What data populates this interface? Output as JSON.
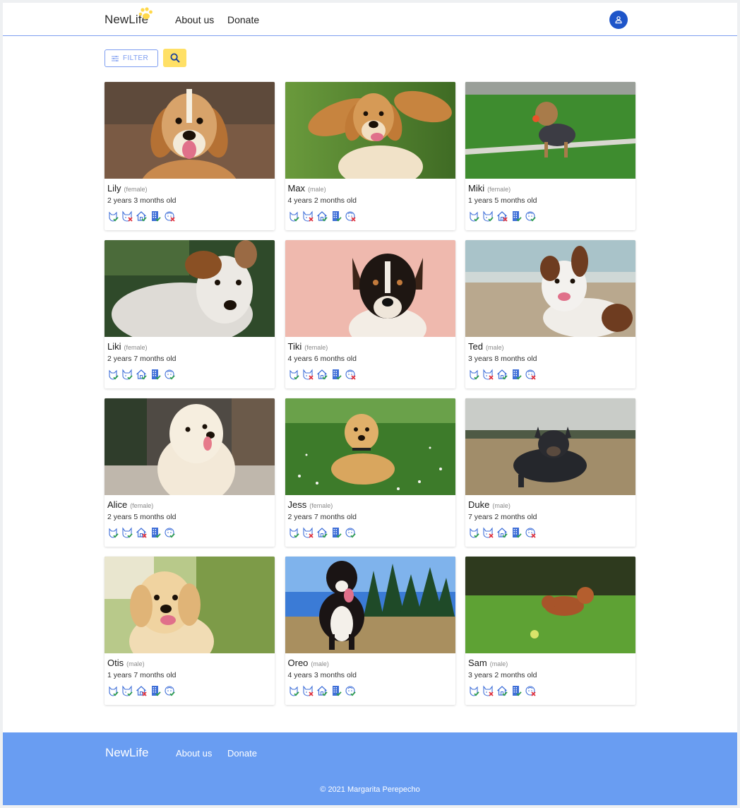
{
  "header": {
    "logo": "NewLife",
    "nav": [
      "About us",
      "Donate"
    ]
  },
  "toolbar": {
    "filter_label": "FILTER"
  },
  "colors": {
    "accent": "#1e55c9",
    "border_blue": "#7d9df0",
    "search_yellow": "#ffe066",
    "footer_blue": "#699df2",
    "ok_green": "#2e9e4c",
    "no_red": "#e2343f",
    "icon_blue": "#3f6fd8"
  },
  "pets": [
    {
      "name": "Lily",
      "gender": "(female)",
      "age": "2 years 3 months old",
      "photo": "beagle-smiling",
      "badges": [
        "ok",
        "no",
        "ok",
        "ok",
        "no"
      ]
    },
    {
      "name": "Max",
      "gender": "(male)",
      "age": "4 years 2 months old",
      "photo": "spaniel-in-grass",
      "badges": [
        "ok",
        "no",
        "ok",
        "ok",
        "no"
      ]
    },
    {
      "name": "Miki",
      "gender": "(female)",
      "age": "1 years 5 months old",
      "photo": "yorkie-with-ball",
      "badges": [
        "ok",
        "ok",
        "no",
        "ok",
        "ok"
      ]
    },
    {
      "name": "Liki",
      "gender": "(female)",
      "age": "2 years 7 months old",
      "photo": "jack-russell-white",
      "badges": [
        "ok",
        "ok",
        "ok",
        "ok",
        "ok"
      ]
    },
    {
      "name": "Tiki",
      "gender": "(female)",
      "age": "4 years 6 months old",
      "photo": "terrier-pink-bg",
      "badges": [
        "ok",
        "no",
        "ok",
        "ok",
        "no"
      ]
    },
    {
      "name": "Ted",
      "gender": "(male)",
      "age": "3 years 8 months old",
      "photo": "collie-mix-beach",
      "badges": [
        "ok",
        "no",
        "ok",
        "ok",
        "no"
      ]
    },
    {
      "name": "Alice",
      "gender": "(female)",
      "age": "2 years 5 months old",
      "photo": "white-fluffy-dog",
      "badges": [
        "ok",
        "ok",
        "no",
        "ok",
        "ok"
      ]
    },
    {
      "name": "Jess",
      "gender": "(female)",
      "age": "2 years 7 months old",
      "photo": "golden-in-meadow",
      "badges": [
        "ok",
        "no",
        "ok",
        "ok",
        "ok"
      ]
    },
    {
      "name": "Duke",
      "gender": "(male)",
      "age": "7 years 2 months old",
      "photo": "french-bulldog-field",
      "badges": [
        "ok",
        "no",
        "ok",
        "ok",
        "no"
      ]
    },
    {
      "name": "Otis",
      "gender": "(male)",
      "age": "1 years 7 months old",
      "photo": "golden-puppy",
      "badges": [
        "ok",
        "ok",
        "no",
        "ok",
        "ok"
      ]
    },
    {
      "name": "Oreo",
      "gender": "(male)",
      "age": "4 years 3 months old",
      "photo": "bernese-forest",
      "badges": [
        "ok",
        "no",
        "ok",
        "ok",
        "ok"
      ]
    },
    {
      "name": "Sam",
      "gender": "(male)",
      "age": "3 years 2 months old",
      "photo": "poodle-jumping",
      "badges": [
        "ok",
        "no",
        "ok",
        "ok",
        "no"
      ]
    }
  ],
  "badge_types": [
    "dogs-icon",
    "cats-icon",
    "house-icon",
    "apartment-icon",
    "kids-icon"
  ],
  "footer": {
    "logo": "NewLife",
    "nav": [
      "About us",
      "Donate"
    ],
    "copyright": "© 2021 Margarita Perepecho"
  }
}
